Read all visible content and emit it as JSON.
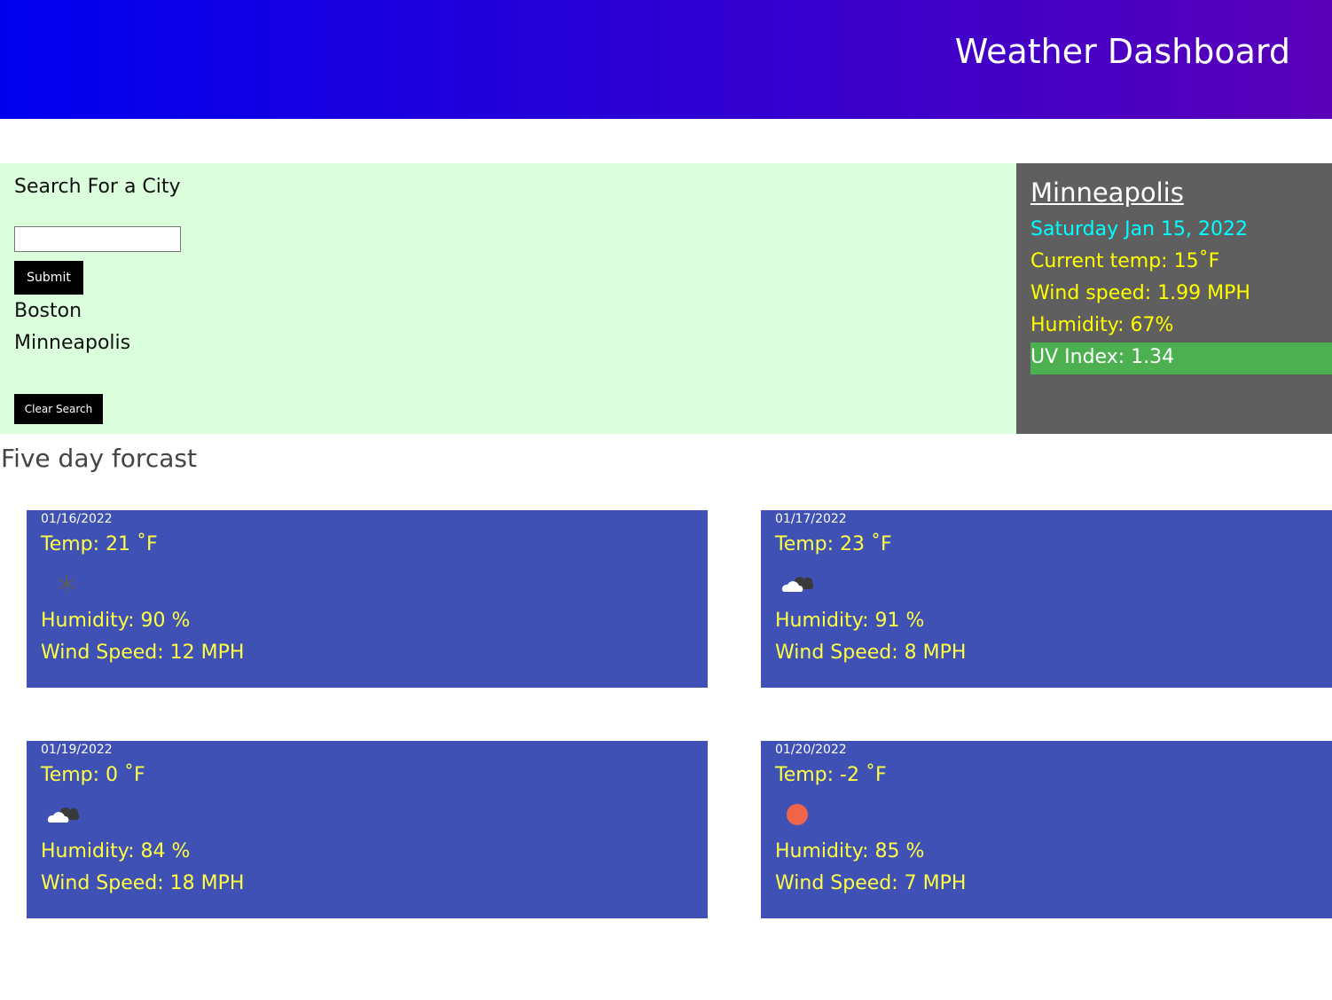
{
  "header": {
    "title": "Weather Dashboard"
  },
  "search": {
    "heading": "Search For a City",
    "input_value": "",
    "submit_label": "Submit",
    "history": [
      "Boston",
      "Minneapolis"
    ],
    "clear_label": "Clear Search"
  },
  "current": {
    "city": "Minneapolis",
    "date": "Saturday Jan 15, 2022",
    "temp": "Current temp: 15˚F",
    "wind": "Wind speed: 1.99 MPH",
    "humidity": "Humidity: 67%",
    "uv": "UV Index: 1.34",
    "uv_color": "#4caf50"
  },
  "forecast": {
    "title": "Five day forcast",
    "days": [
      {
        "date": "01/16/2022",
        "temp": "Temp: 21 ˚F",
        "icon": "snow-icon",
        "humidity": "Humidity: 90 %",
        "wind": "Wind Speed: 12 MPH"
      },
      {
        "date": "01/17/2022",
        "temp": "Temp: 23 ˚F",
        "icon": "cloudy-icon",
        "humidity": "Humidity: 91 %",
        "wind": "Wind Speed: 8 MPH"
      },
      {
        "date": "01/19/2022",
        "temp": "Temp: 0 ˚F",
        "icon": "cloudy-icon",
        "humidity": "Humidity: 84 %",
        "wind": "Wind Speed: 18 MPH"
      },
      {
        "date": "01/20/2022",
        "temp": "Temp: -2 ˚F",
        "icon": "sun-icon",
        "humidity": "Humidity: 85 %",
        "wind": "Wind Speed: 7 MPH"
      }
    ]
  },
  "colors": {
    "header_gradient_start": "#0000f0",
    "header_gradient_end": "#5a00b8",
    "search_panel_bg": "#dbfedd",
    "current_panel_bg": "#5f5f5f",
    "card_bg": "#3f51b5",
    "accent_yellow": "#ffff00",
    "accent_cyan": "#00ffff"
  }
}
